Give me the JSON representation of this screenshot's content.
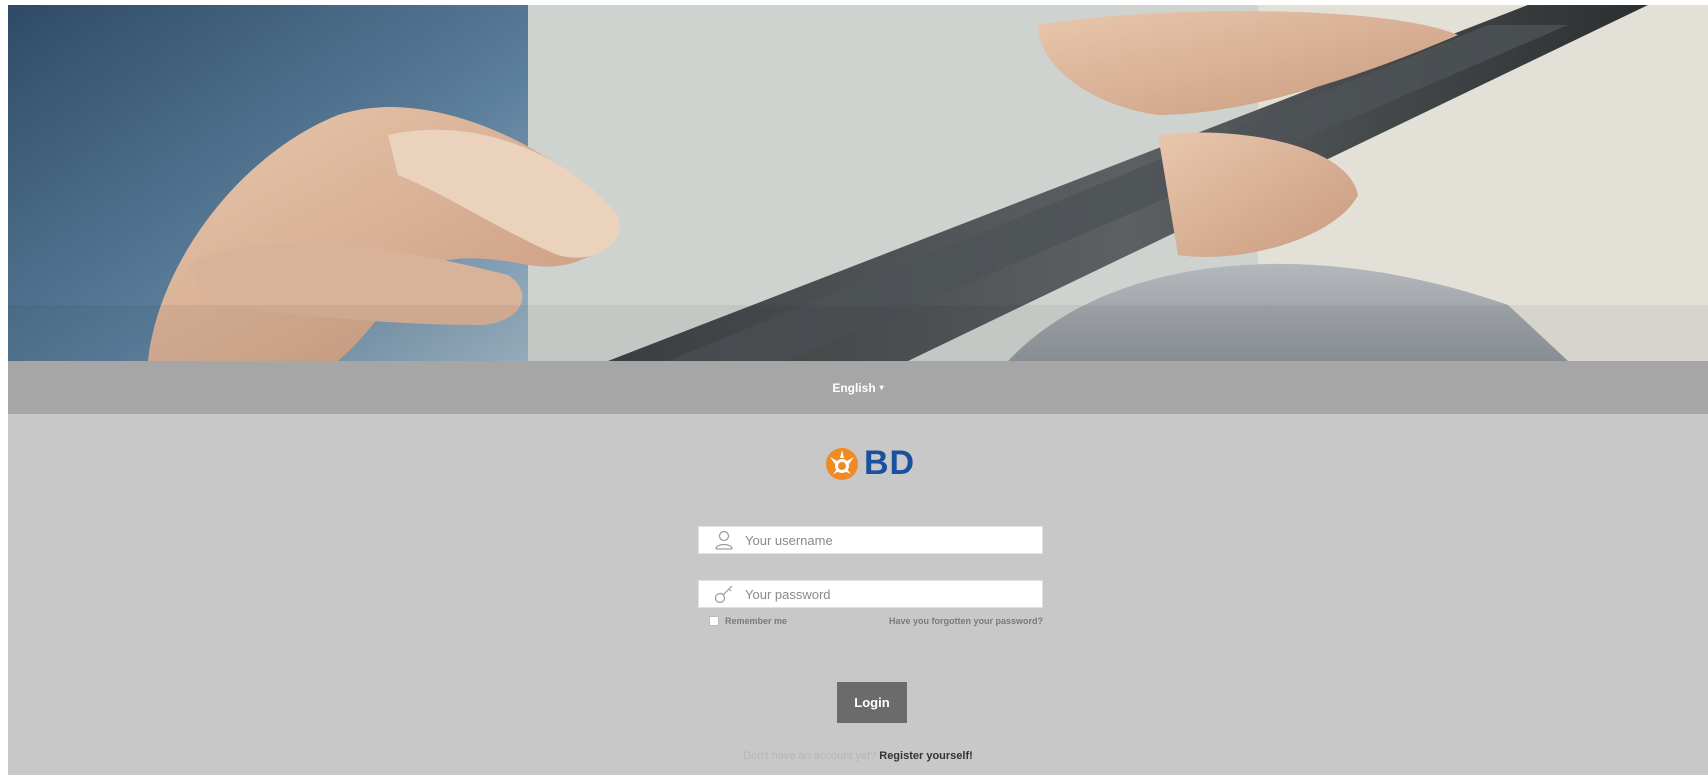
{
  "language": {
    "selected": "English",
    "caret": "▾"
  },
  "logo": {
    "text": "BD",
    "colors": {
      "mark": "#f08a24",
      "text": "#1b4fa0"
    }
  },
  "form": {
    "username_placeholder": "Your username",
    "password_placeholder": "Your password",
    "remember_label": "Remember me",
    "forgot_link": "Have you forgotten your password?",
    "login_label": "Login"
  },
  "register": {
    "prompt": "Don't have an account yet?",
    "link": "Register yourself!"
  },
  "icons": {
    "username": "user-icon",
    "password": "key-icon",
    "language": "chevron-down-icon",
    "logo": "bd-starburst-logo"
  },
  "colors": {
    "language_bar": "#a6a6a6",
    "login_background": "#c8c8c8",
    "button": "#6b6b6b"
  }
}
